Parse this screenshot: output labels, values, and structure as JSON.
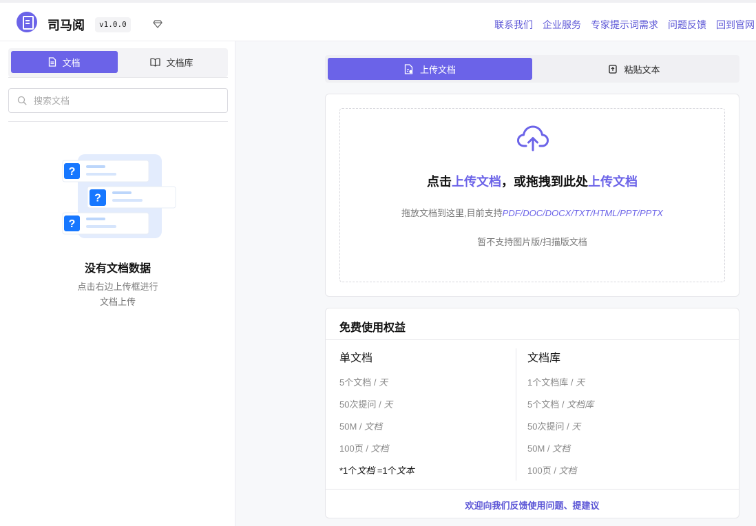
{
  "app": {
    "title": "司马阅",
    "version": "v1.0.0"
  },
  "topnav": [
    "联系我们",
    "企业服务",
    "专家提示词需求",
    "问题反馈",
    "回到官网"
  ],
  "sidebar": {
    "tabs": [
      {
        "label": "文档",
        "icon": "document-icon",
        "active": true
      },
      {
        "label": "文档库",
        "icon": "book-icon",
        "active": false
      }
    ],
    "search_placeholder": "搜索文档",
    "empty_title": "没有文档数据",
    "empty_desc_line1": "点击右边上传框进行",
    "empty_desc_line2": "文档上传"
  },
  "main": {
    "tabs": [
      {
        "label": "上传文档",
        "icon": "upload-file-icon",
        "active": true
      },
      {
        "label": "粘贴文本",
        "icon": "paste-icon",
        "active": false
      }
    ],
    "upload": {
      "headline_1": "点击",
      "headline_2": "上传文档",
      "headline_3": "，或拖拽到此处",
      "headline_4": "上传文档",
      "sub_prefix": "拖放文档到这里,目前支持",
      "sub_formats": "PDF/DOC/DOCX/TXT/HTML/PPT/PPTX",
      "note": "暂不支持图片版/扫描版文档"
    },
    "benefits": {
      "title": "免费使用权益",
      "left": {
        "title": "单文档",
        "items": [
          {
            "value": "5个文档",
            "unit": "天"
          },
          {
            "value": "50次提问",
            "unit": "天"
          },
          {
            "value": "50M",
            "unit": "文档"
          },
          {
            "value": "100页",
            "unit": "文档"
          }
        ],
        "note_a": "*1个",
        "note_b": "文档",
        "note_c": " =1个",
        "note_d": "文本"
      },
      "right": {
        "title": "文档库",
        "items": [
          {
            "value": "1个文档库",
            "unit": "天"
          },
          {
            "value": "5个文档",
            "unit": "文档库"
          },
          {
            "value": "50次提问",
            "unit": "天"
          },
          {
            "value": "50M",
            "unit": "文档"
          },
          {
            "value": "100页",
            "unit": "文档"
          }
        ]
      },
      "feedback": "欢迎向我们反馈使用问题、提建议"
    }
  },
  "colors": {
    "accent": "#6b63e8",
    "link": "#5b55d6"
  }
}
